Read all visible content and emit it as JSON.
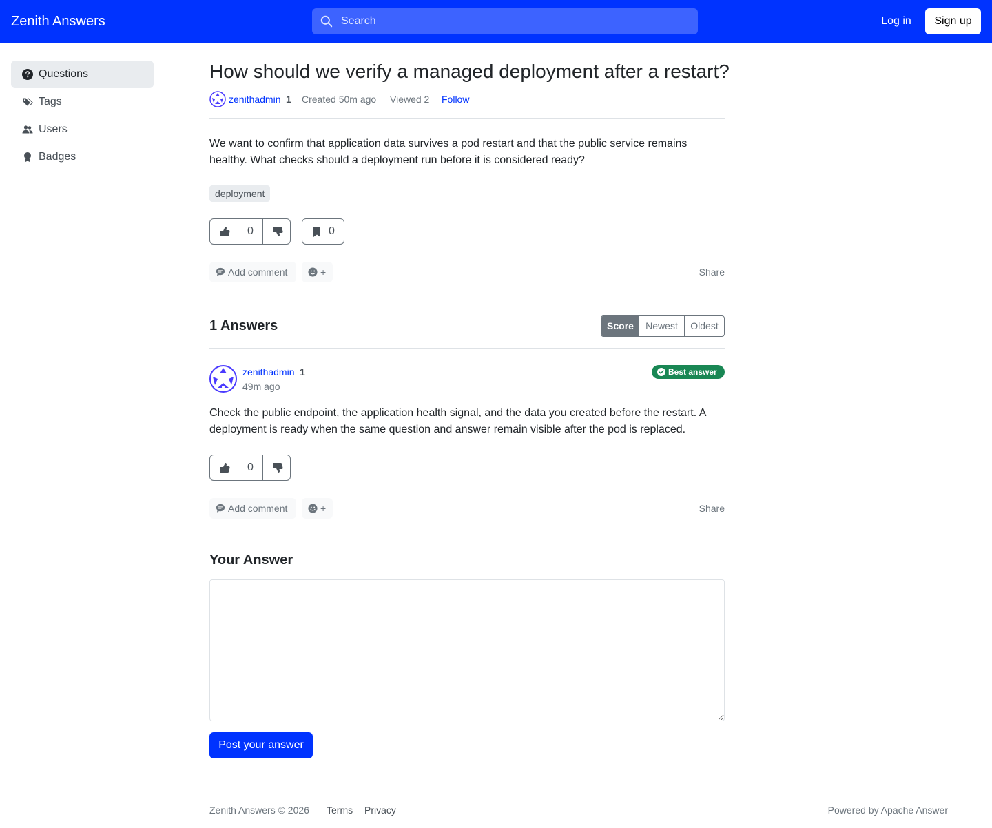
{
  "header": {
    "brand": "Zenith Answers",
    "search_placeholder": "Search",
    "login_label": "Log in",
    "signup_label": "Sign up"
  },
  "sidebar": {
    "items": [
      {
        "label": "Questions",
        "icon": "question-circle-icon",
        "active": true
      },
      {
        "label": "Tags",
        "icon": "tags-icon",
        "active": false
      },
      {
        "label": "Users",
        "icon": "people-icon",
        "active": false
      },
      {
        "label": "Badges",
        "icon": "award-icon",
        "active": false
      }
    ]
  },
  "question": {
    "title": "How should we verify a managed deployment after a restart?",
    "author": "zenithadmin",
    "author_rep": "1",
    "created": "Created 50m ago",
    "viewed": "Viewed 2",
    "follow_label": "Follow",
    "body": "We want to confirm that application data survives a pod restart and that the public service remains healthy. What checks should a deployment run before it is considered ready?",
    "tags": [
      "deployment"
    ],
    "votes": "0",
    "bookmarks": "0",
    "add_comment_label": "Add comment",
    "react_label": "+",
    "share_label": "Share"
  },
  "answers": {
    "heading": "1 Answers",
    "sort_options": [
      "Score",
      "Newest",
      "Oldest"
    ],
    "sort_selected": "Score",
    "items": [
      {
        "author": "zenithadmin",
        "author_rep": "1",
        "time": "49m ago",
        "badge": "Best answer",
        "body": "Check the public endpoint, the application health signal, and the data you created before the restart. A deployment is ready when the same question and answer remain visible after the pod is replaced.",
        "votes": "0",
        "add_comment_label": "Add comment",
        "react_label": "+",
        "share_label": "Share"
      }
    ]
  },
  "editor": {
    "heading": "Your Answer",
    "value": "",
    "submit_label": "Post your answer"
  },
  "footer": {
    "copyright": "Zenith Answers © 2026",
    "terms": "Terms",
    "privacy": "Privacy",
    "powered_by": "Powered by Apache Answer"
  },
  "colors": {
    "brand": "#0033ff",
    "search_bg": "#3d63ff",
    "success": "#198754",
    "muted": "#6c757d"
  }
}
